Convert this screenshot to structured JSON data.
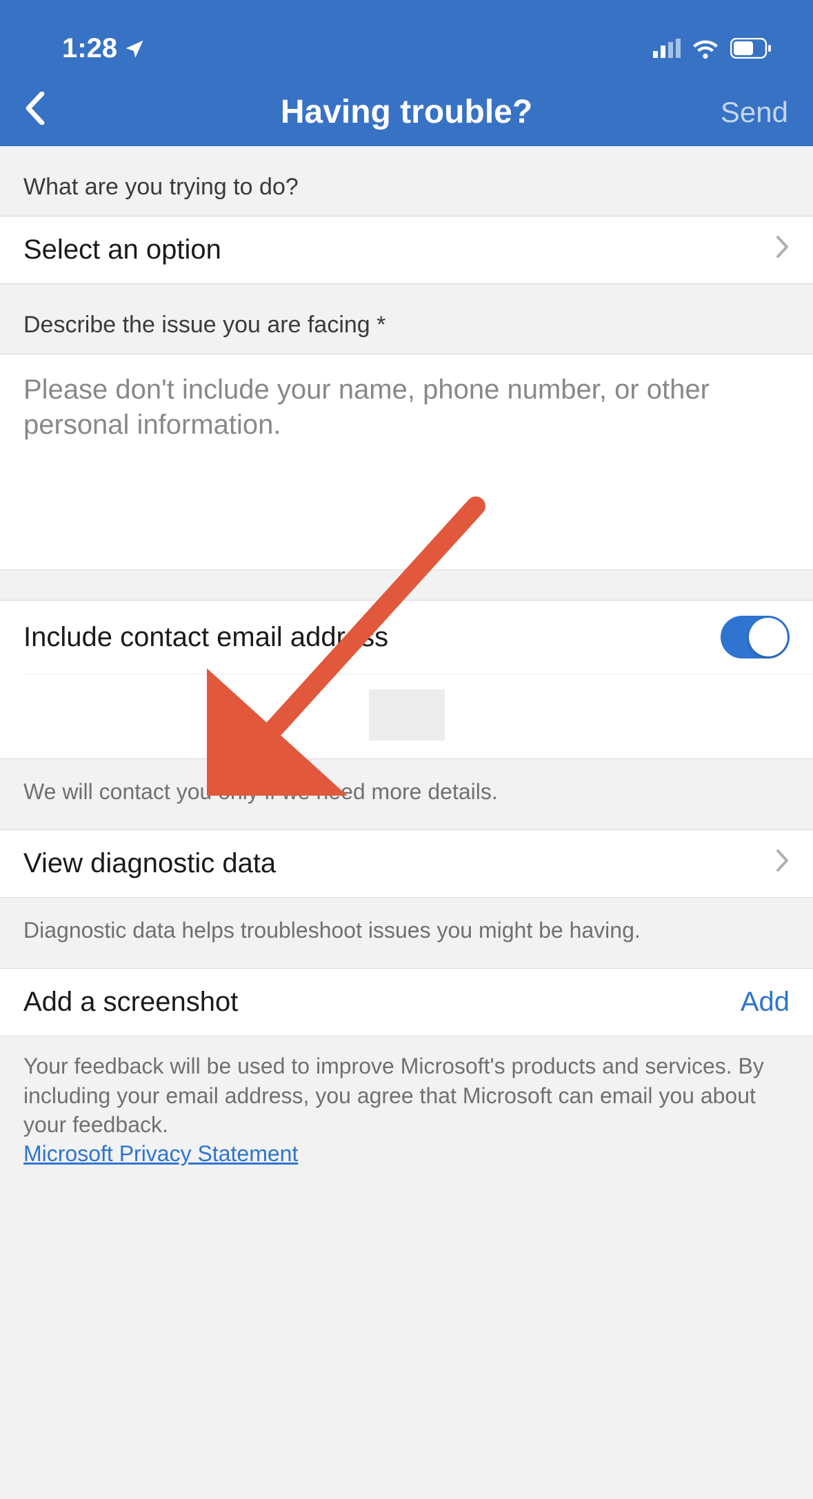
{
  "status": {
    "time": "1:28"
  },
  "nav": {
    "title": "Having trouble?",
    "send": "Send"
  },
  "section1": {
    "label": "What are you trying to do?",
    "select_placeholder": "Select an option"
  },
  "section2": {
    "label": "Describe the issue you are facing *",
    "placeholder": "Please don't include your name, phone number, or other personal information."
  },
  "email": {
    "toggle_label": "Include contact email address",
    "toggle_on": true,
    "note": "We will contact you only if we need more details."
  },
  "diag": {
    "label": "View diagnostic data",
    "note": "Diagnostic data helps troubleshoot issues you might be having."
  },
  "screenshot": {
    "label": "Add a screenshot",
    "action": "Add"
  },
  "footer": {
    "text": "Your feedback will be used to improve Microsoft's products and services. By including your email address, you agree that Microsoft can email you about your feedback.",
    "link": "Microsoft Privacy Statement"
  }
}
